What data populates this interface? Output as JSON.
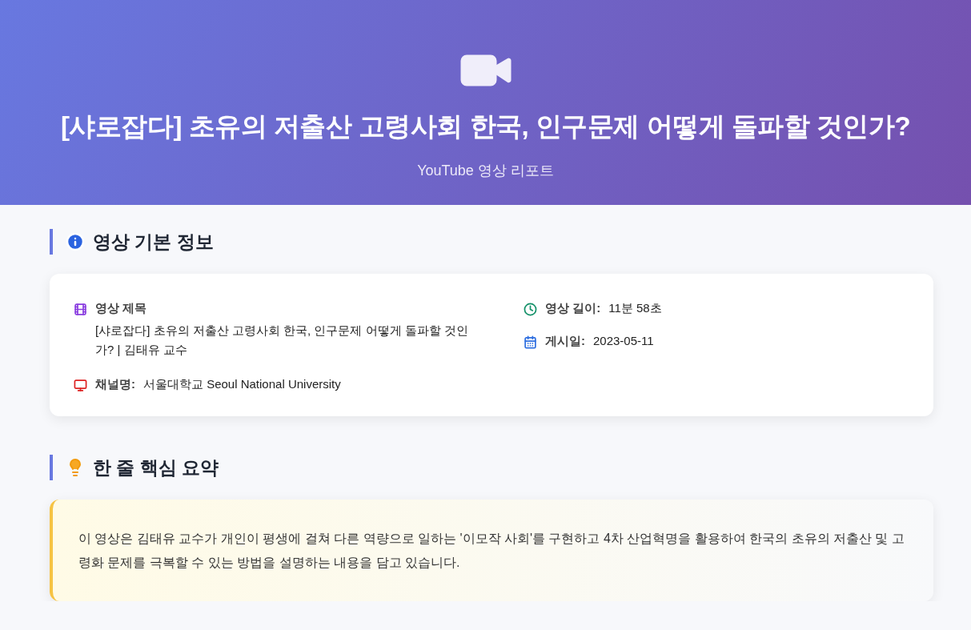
{
  "header": {
    "title": "[샤로잡다] 초유의 저출산 고령사회 한국, 인구문제 어떻게 돌파할 것인가?",
    "subtitle": "YouTube 영상 리포트"
  },
  "info_section": {
    "heading": "영상 기본 정보",
    "columns": [
      [
        {
          "kind": "stacked",
          "label": "영상 제목",
          "value": "[샤로잡다] 초유의 저출산 고령사회 한국, 인구문제 어떻게 돌파할 것인가? | 김태유 교수"
        },
        {
          "kind": "inline",
          "label": "채널명:",
          "value": "서울대학교 Seoul National University"
        }
      ],
      [
        {
          "kind": "inline",
          "label": "영상 길이:",
          "value": "11분 58초"
        },
        {
          "kind": "inline",
          "label": "게시일:",
          "value": "2023-05-11"
        }
      ]
    ]
  },
  "summary_section": {
    "heading": "한 줄 핵심 요약",
    "text": "이 영상은 김태유 교수가 개인이 평생에 걸쳐 다른 역량으로 일하는 '이모작 사회'를 구현하고 4차 산업혁명을 활용하여 한국의 초유의 저출산 및 고령화 문제를 극복할 수 있는 방법을 설명하는 내용을 담고 있습니다."
  }
}
